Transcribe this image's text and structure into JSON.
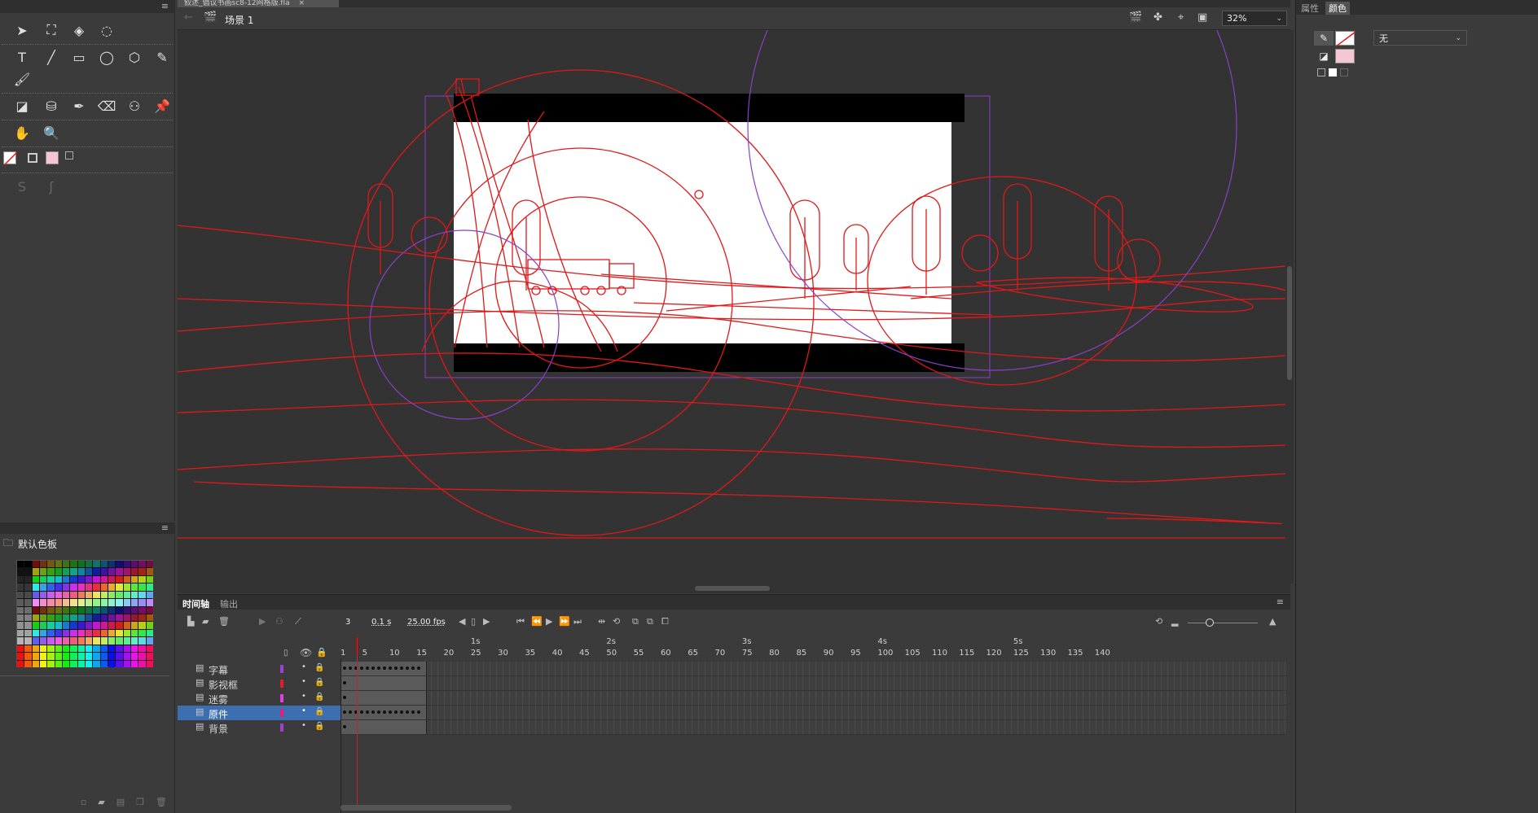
{
  "document": {
    "tab_title": "叙述_倡议书画sc8-12网格版.fla",
    "tab_close": "×",
    "scene_label": "场景 1",
    "zoom": "32%"
  },
  "timeline": {
    "tabs": [
      "时间轴",
      "输出"
    ],
    "current_frame": "3",
    "elapsed_time": "0.1 s",
    "fps": "25.00 fps",
    "ruler_numbers": [
      "1",
      "5",
      "10",
      "15",
      "20",
      "25",
      "30",
      "35",
      "40",
      "45",
      "50",
      "55",
      "60",
      "65",
      "70",
      "75",
      "80",
      "85",
      "90",
      "95",
      "100",
      "105",
      "110",
      "115",
      "120",
      "125",
      "130",
      "135",
      "140"
    ],
    "ruler_seconds": [
      "1s",
      "2s",
      "3s",
      "4s",
      "5s"
    ],
    "layers": [
      {
        "name": "字幕",
        "color": "#a040d0",
        "selected": false
      },
      {
        "name": "影视框",
        "color": "#e02020",
        "selected": false
      },
      {
        "name": "迷雾",
        "color": "#e040e0",
        "selected": false
      },
      {
        "name": "原件",
        "color": "#e02080",
        "selected": true
      },
      {
        "name": "背景",
        "color": "#a040d0",
        "selected": false
      }
    ]
  },
  "swatches": {
    "title": "默认色板"
  },
  "right_panel": {
    "tabs": [
      "属性",
      "颜色"
    ],
    "active_tab": "颜色",
    "fill_type": "无",
    "stroke_color": "none",
    "fill_color": "#f5c6d4"
  },
  "colors": {
    "guide_red": "#e01818",
    "guide_purple": "#8a3fc8",
    "stage_white": "#ffffff",
    "selection_blue": "#3d6fb0"
  }
}
